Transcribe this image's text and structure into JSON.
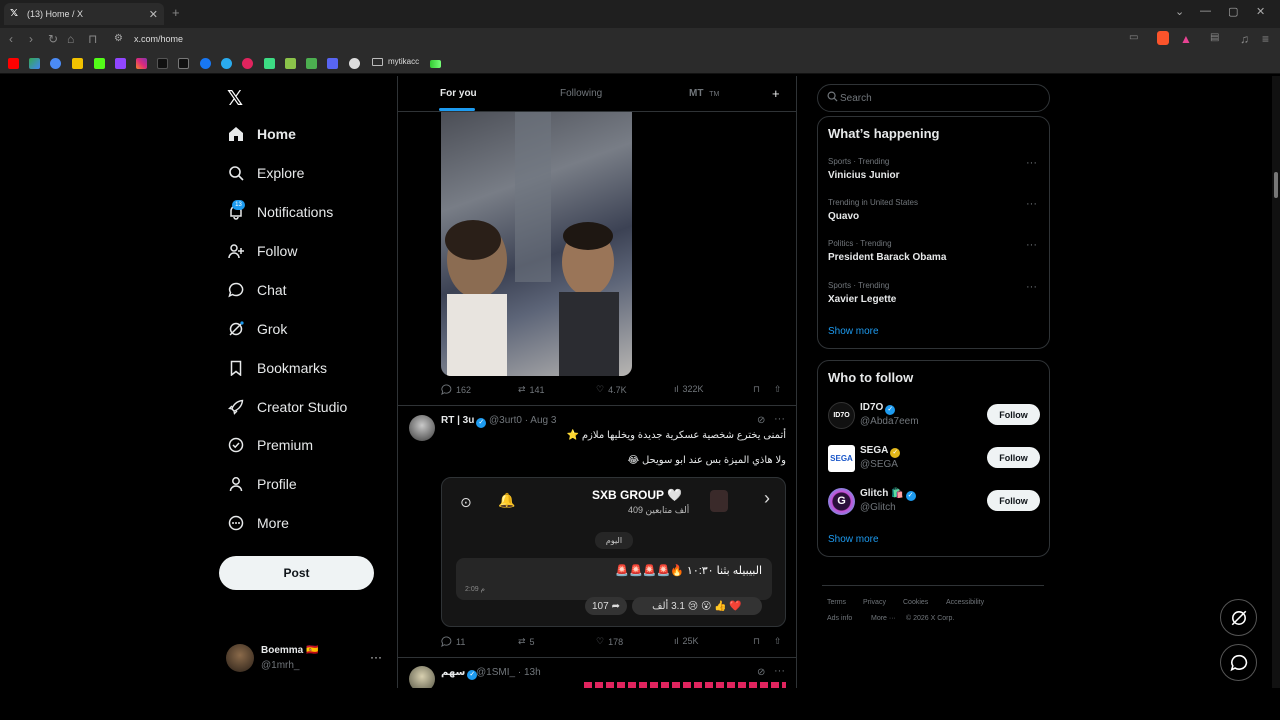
{
  "browser": {
    "tab_title": "(13) Home / X",
    "tab_icon": "x-logo",
    "url": "x.com/home",
    "bookmark_folder": "mytikacc",
    "bookmark_icons": [
      "youtube",
      "google-play",
      "gemini",
      "mango",
      "kick",
      "twitch",
      "instagram",
      "tiktok",
      "x",
      "facebook",
      "telegram",
      "ios-app",
      "android",
      "robot",
      "arrow-up",
      "discord",
      "globe"
    ]
  },
  "nav": {
    "logo": "𝕏",
    "items": [
      {
        "label": "Home",
        "icon": "home-icon"
      },
      {
        "label": "Explore",
        "icon": "search-icon"
      },
      {
        "label": "Notifications",
        "icon": "bell-icon"
      },
      {
        "label": "Follow",
        "icon": "person-add-icon"
      },
      {
        "label": "Chat",
        "icon": "chat-icon"
      },
      {
        "label": "Grok",
        "icon": "grok-icon"
      },
      {
        "label": "Bookmarks",
        "icon": "bookmark-icon"
      },
      {
        "label": "Creator Studio",
        "icon": "rocket-icon"
      },
      {
        "label": "Premium",
        "icon": "verified-icon"
      },
      {
        "label": "Profile",
        "icon": "person-icon"
      },
      {
        "label": "More",
        "icon": "more-circle-icon"
      }
    ],
    "notifications_badge": "13",
    "post_label": "Post",
    "user": {
      "name": "Boemma 🇪🇸",
      "handle": "@1mrh_"
    }
  },
  "feed": {
    "tabs": [
      {
        "label": "For you",
        "active": true
      },
      {
        "label": "Following",
        "active": false
      },
      {
        "label": "MT",
        "active": false
      }
    ],
    "tab_extra": "TM",
    "tweet1": {
      "stats": {
        "replies": "162",
        "reposts": "141",
        "likes": "4.7K",
        "views": "322K"
      }
    },
    "tweet2": {
      "name": "RT | 3u",
      "handle": "@3urt0",
      "time": "· Aug 3",
      "line1": "أتمنى يخترع شخصية عسكرية جديدة ويخليها ملازم ⭐",
      "line2": "ولا هاذي الميزة بس عند ابو سويحل 😂",
      "card": {
        "title": "SXB GROUP 🤍",
        "subtitle": "409 ألف متابعين",
        "today": "اليوم",
        "message": "البيبيله بثنا ١٠:٣٠ 🔥🚨🚨🚨🚨",
        "time": "2:09 م",
        "reactions": "❤️ 👍 😮 😢 3.1 ألف",
        "shares": "107"
      },
      "stats": {
        "replies": "11",
        "reposts": "5",
        "likes": "178",
        "views": "25K"
      }
    },
    "tweet3": {
      "name": "سهم",
      "handle": "@1SMI_",
      "time": "· 13h"
    }
  },
  "right": {
    "search_placeholder": "Search",
    "happening_title": "What’s happening",
    "trends": [
      {
        "meta": "Sports · Trending",
        "name": "Vinicius Junior"
      },
      {
        "meta": "Trending in United States",
        "name": "Quavo"
      },
      {
        "meta": "Politics · Trending",
        "name": "President Barack Obama"
      },
      {
        "meta": "Sports · Trending",
        "name": "Xavier Legette"
      }
    ],
    "show_more": "Show more",
    "wtf_title": "Who to follow",
    "who_to_follow": [
      {
        "name": "ID7O",
        "handle": "@Abda7eem",
        "badge": "blue",
        "avatar_text": "ID7O",
        "avatar_color": "#111111"
      },
      {
        "name": "SEGA",
        "handle": "@SEGA",
        "badge": "gold",
        "avatar_text": "SEGA",
        "avatar_color": "#ffffff"
      },
      {
        "name": "Glitch 🛍️",
        "handle": "@Glitch",
        "badge": "blue",
        "avatar_text": "G",
        "avatar_color": "#2a0f3a"
      }
    ],
    "follow_label": "Follow",
    "footer_row1": [
      "Terms",
      "Privacy",
      "Cookies",
      "Accessibility"
    ],
    "footer_more": "Ads info",
    "footer_more2": "More ···",
    "footer_copy": "© 2026 X Corp."
  },
  "colors": {
    "accent": "#1d9bf0",
    "gold": "#e2b719",
    "background": "#000000",
    "text": "#e7e9ea",
    "muted": "#71767b"
  }
}
